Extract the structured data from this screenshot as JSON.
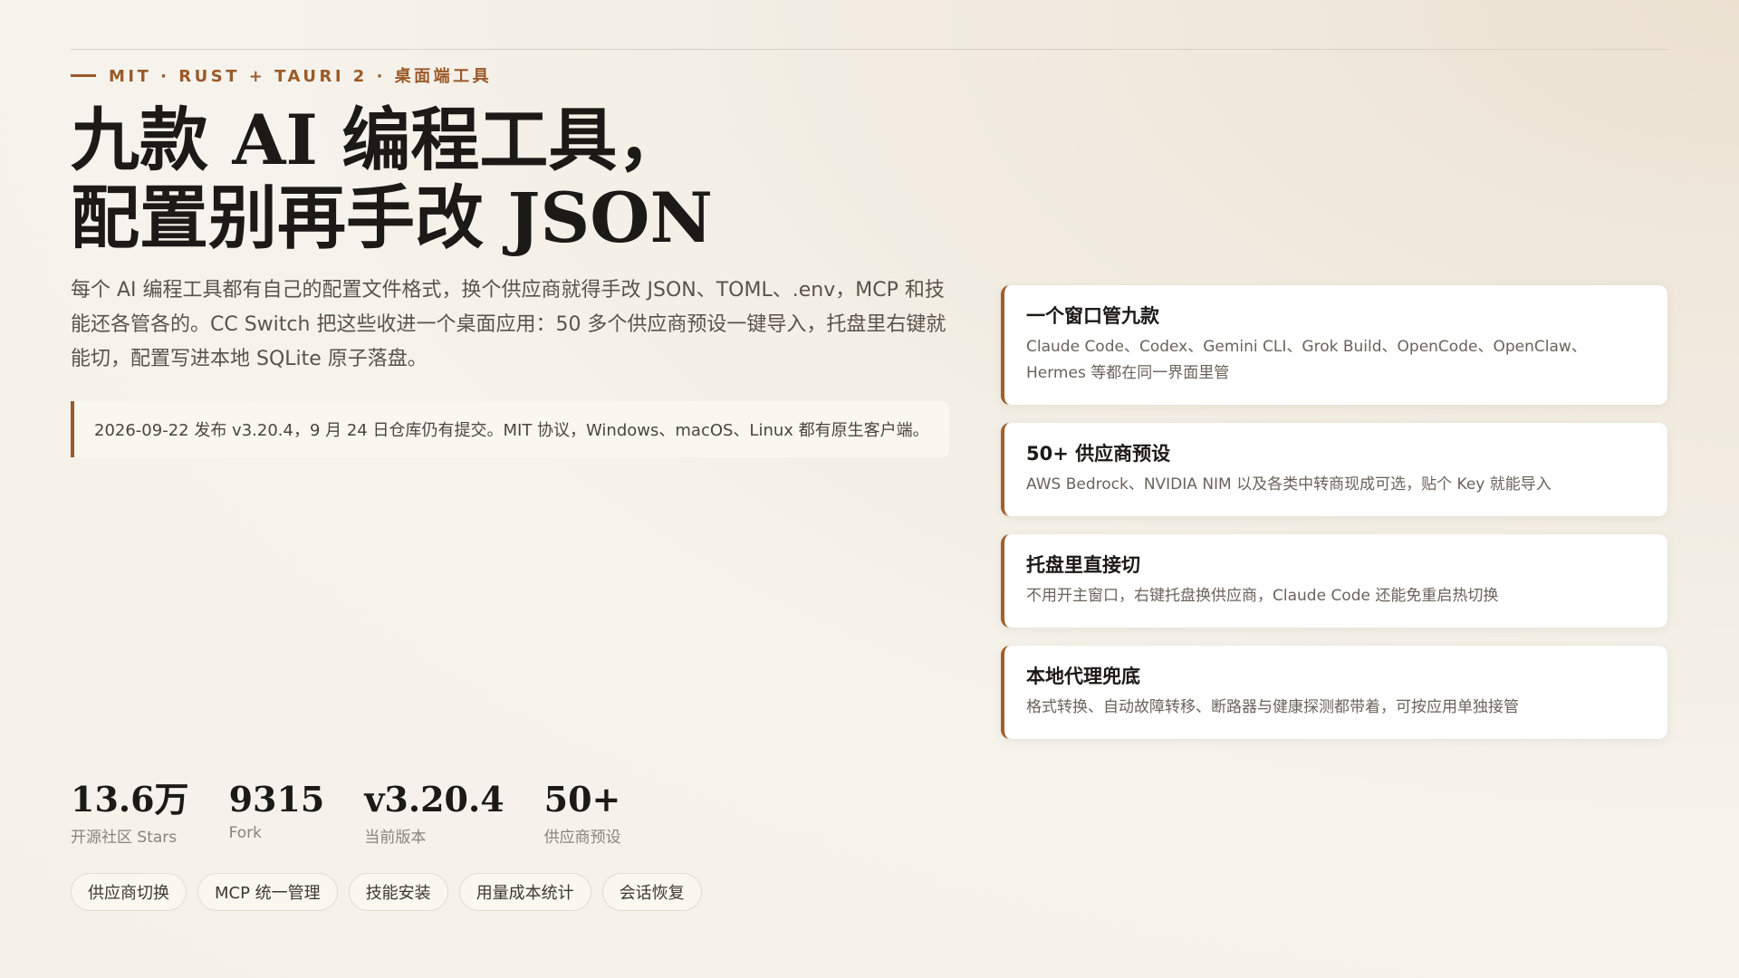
{
  "hero": {
    "eyebrow": "MIT · RUST + TAURI 2 · 桌面端工具",
    "headline_line1": "九款 AI 编程工具，",
    "headline_line2": "配置别再手改 JSON",
    "intro": "每个 AI 编程工具都有自己的配置文件格式，换个供应商就得手改 JSON、TOML、.env，MCP 和技能还各管各的。CC Switch 把这些收进一个桌面应用：50 多个供应商预设一键导入，托盘里右键就能切，配置写进本地 SQLite 原子落盘。",
    "release_note": "2026-09-22 发布 v3.20.4，9 月 24 日仓库仍有提交。MIT 协议，Windows、macOS、Linux 都有原生客户端。"
  },
  "features": [
    {
      "title": "一个窗口管九款",
      "desc": "Claude Code、Codex、Gemini CLI、Grok Build、OpenCode、OpenClaw、Hermes 等都在同一界面里管"
    },
    {
      "title": "50+ 供应商预设",
      "desc": "AWS Bedrock、NVIDIA NIM 以及各类中转商现成可选，贴个 Key 就能导入"
    },
    {
      "title": "托盘里直接切",
      "desc": "不用开主窗口，右键托盘换供应商，Claude Code 还能免重启热切换"
    },
    {
      "title": "本地代理兜底",
      "desc": "格式转换、自动故障转移、断路器与健康探测都带着，可按应用单独接管"
    }
  ],
  "stats": [
    {
      "value": "13.6万",
      "label": "开源社区 Stars"
    },
    {
      "value": "9315",
      "label": "Fork"
    },
    {
      "value": "v3.20.4",
      "label": "当前版本"
    },
    {
      "value": "50+",
      "label": "供应商预设"
    }
  ],
  "tags": [
    "供应商切换",
    "MCP 统一管理",
    "技能安装",
    "用量成本统计",
    "会话恢复"
  ],
  "colors": {
    "accent": "#9a5a2a",
    "headline": "#1c1a17",
    "background": "#f5f1ea"
  }
}
